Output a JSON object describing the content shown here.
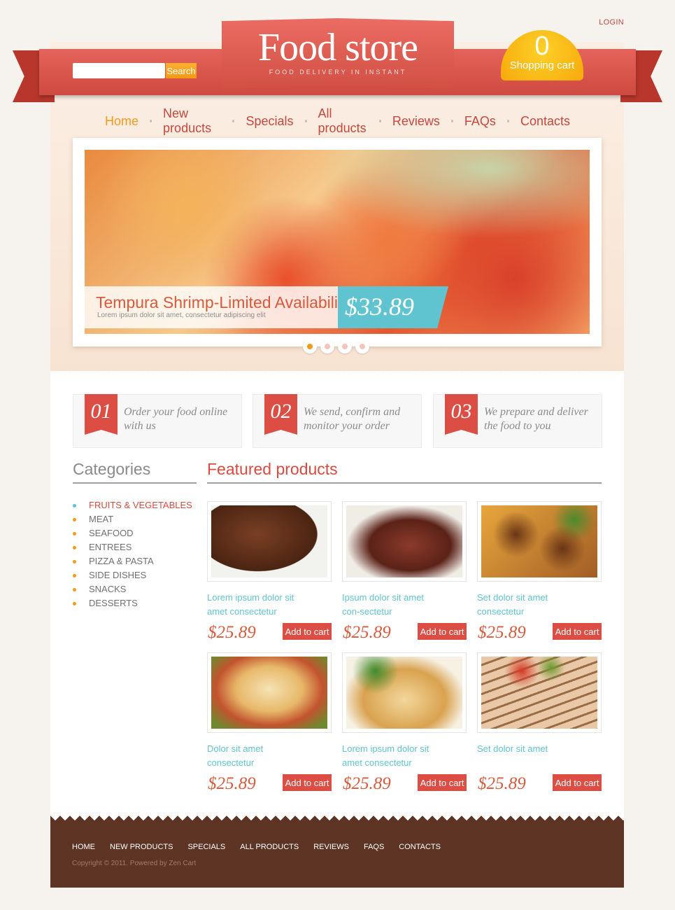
{
  "header": {
    "login": "LOGIN",
    "logo_title": "Food store",
    "logo_tagline": "FOOD DELIVERY IN INSTANT",
    "search_placeholder": "",
    "search_button": "Search",
    "cart_count": "0",
    "cart_label": "Shopping cart"
  },
  "nav": {
    "items": [
      {
        "label": "Home",
        "active": true
      },
      {
        "label": "New products"
      },
      {
        "label": "Specials"
      },
      {
        "label": "All products"
      },
      {
        "label": "Reviews"
      },
      {
        "label": "FAQs"
      },
      {
        "label": "Contacts"
      }
    ]
  },
  "slider": {
    "title": "Tempura Shrimp-Limited Availability",
    "subtitle": "Lorem ipsum dolor sit amet, consectetur adipiscing elit",
    "price": "$33.89",
    "slide_count": 4,
    "active_slide": 1
  },
  "steps": [
    {
      "num": "01",
      "text": "Order your food online with us"
    },
    {
      "num": "02",
      "text": "We send, confirm and monitor your order"
    },
    {
      "num": "03",
      "text": "We prepare and deliver the food to you"
    }
  ],
  "categories": {
    "title": "Categories",
    "items": [
      "FRUITS & VEGETABLES",
      "MEAT",
      "SEAFOOD",
      "ENTREES",
      "PIZZA & PASTA",
      "SIDE DISHES",
      "SNACKS",
      "DESSERTS"
    ]
  },
  "featured": {
    "title": "Featured products",
    "add_label": "Add to cart",
    "products": [
      {
        "name": "Lorem ipsum dolor sit amet consectetur",
        "price": "$25.89"
      },
      {
        "name": "Ipsum dolor sit amet con-sectetur",
        "price": "$25.89"
      },
      {
        "name": "Set dolor sit amet consectetur",
        "price": "$25.89"
      },
      {
        "name": "Dolor sit amet consectetur",
        "price": "$25.89"
      },
      {
        "name": "Lorem ipsum dolor sit amet consectetur",
        "price": "$25.89"
      },
      {
        "name": "Set dolor sit amet",
        "price": "$25.89"
      }
    ]
  },
  "footer": {
    "links": [
      "HOME",
      "NEW PRODUCTS",
      "SPECIALS",
      "ALL PRODUCTS",
      "REVIEWS",
      "FAQS",
      "CONTACTS"
    ],
    "copyright": "Copyright © 2011. Powered by Zen Cart"
  },
  "colors": {
    "accent_red": "#dc4e44",
    "accent_orange": "#f29a1b",
    "accent_teal": "#5fc4d0",
    "footer_brown": "#5e3424"
  }
}
